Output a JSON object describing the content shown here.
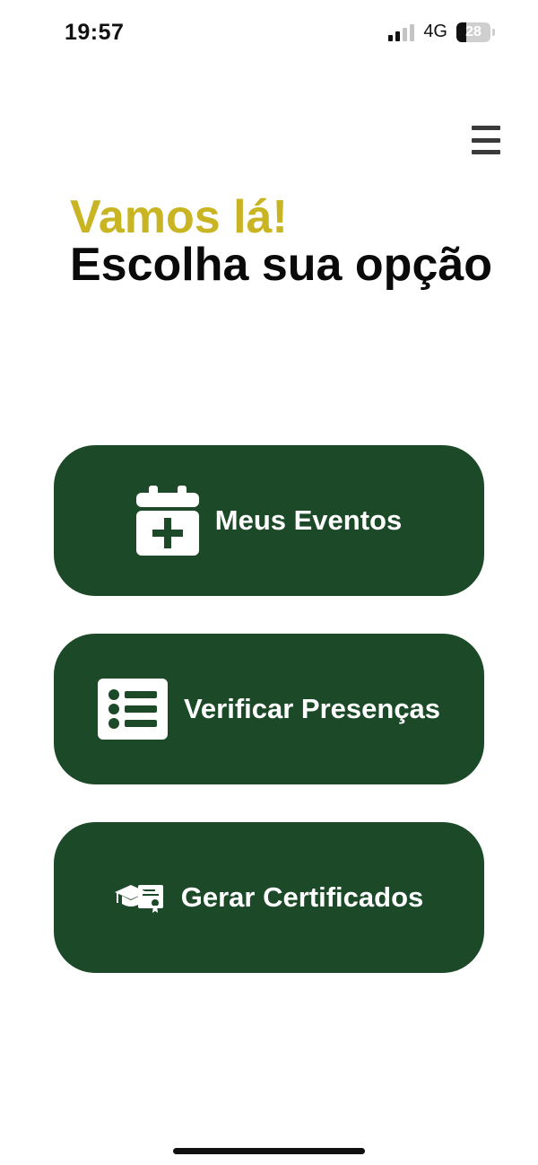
{
  "status_bar": {
    "time": "19:57",
    "network": "4G",
    "battery_level": "28"
  },
  "header": {
    "menu_icon": "hamburger-menu-icon"
  },
  "heading": {
    "greeting": "Vamos lá!",
    "subtitle": "Escolha sua opção"
  },
  "options": [
    {
      "label": "Meus Eventos",
      "icon": "calendar-plus-icon"
    },
    {
      "label": "Verificar Presenças",
      "icon": "list-icon"
    },
    {
      "label": "Gerar Certificados",
      "icon": "graduation-certificate-icon"
    }
  ],
  "colors": {
    "accent": "#c9b524",
    "button_bg": "#1c4a28",
    "text_dark": "#0a0a0a",
    "button_text": "#ffffff"
  }
}
